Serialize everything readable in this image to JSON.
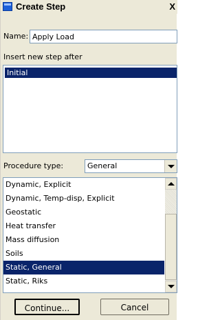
{
  "window": {
    "title": "Create Step",
    "close_glyph": "X",
    "title_icon": "window-icon"
  },
  "name": {
    "label": "Name:",
    "value": "Apply Load"
  },
  "insert_after": {
    "label": "Insert new step after",
    "items": [
      "Initial"
    ],
    "selected": "Initial"
  },
  "procedure": {
    "label": "Procedure type:",
    "selected": "General",
    "types": [
      "Dynamic, Explicit",
      "Dynamic, Temp-disp, Explicit",
      "Geostatic",
      "Heat transfer",
      "Mass diffusion",
      "Soils",
      "Static, General",
      "Static, Riks"
    ],
    "selected_type": "Static, General"
  },
  "buttons": {
    "continue_label": "Continue...",
    "cancel_label": "Cancel"
  },
  "colors": {
    "selection": "#0a246a",
    "dialog_bg": "#ece9d8"
  }
}
